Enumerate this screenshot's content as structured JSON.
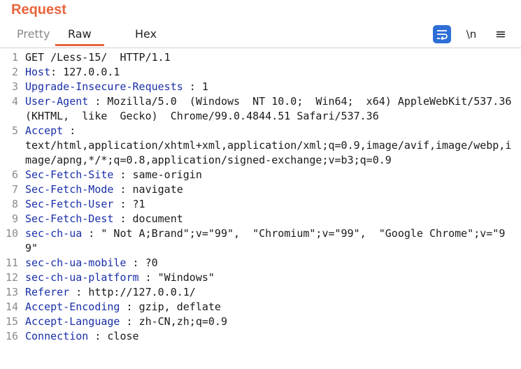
{
  "panel": {
    "title": "Request"
  },
  "tabs": [
    {
      "label": "Pretty",
      "active": false
    },
    {
      "label": "Raw",
      "active": true
    },
    {
      "label": "Hex",
      "active": false
    }
  ],
  "toolbar": {
    "newline_label": "\\n",
    "menu_label": "≡"
  },
  "colors": {
    "accent": "#e8643c",
    "header_name": "#1a2fa8",
    "line_number": "#8a8a8a",
    "wrap_button_bg": "#2e6fd6"
  },
  "icons": {
    "wrap": "wrap-text-icon",
    "newline": "show-newlines-icon",
    "menu": "hamburger-menu-icon"
  },
  "request": {
    "lines": [
      {
        "num": "1",
        "text": "GET /Less-15/  HTTP/1.1"
      },
      {
        "num": "2",
        "name": "Host",
        "sep": ": ",
        "value": "127.0.0.1"
      },
      {
        "num": "3",
        "name": "Upgrade-Insecure-Requests",
        "sep": " : ",
        "value": "1"
      },
      {
        "num": "4",
        "name": "User-Agent",
        "sep": " : ",
        "value": "Mozilla/5.0  (Windows  NT 10.0;  Win64;  x64) AppleWebKit/537.36  (KHTML,  like  Gecko)  Chrome/99.0.4844.51 Safari/537.36"
      },
      {
        "num": "5",
        "name": "Accept",
        "sep": " :",
        "value": "\ntext/html,application/xhtml+xml,application/xml;q=0.9,image/avif,image/webp,image/apng,*/*;q=0.8,application/signed-exchange;v=b3;q=0.9"
      },
      {
        "num": "6",
        "name": "Sec-Fetch-Site",
        "sep": " : ",
        "value": "same-origin"
      },
      {
        "num": "7",
        "name": "Sec-Fetch-Mode",
        "sep": " : ",
        "value": "navigate"
      },
      {
        "num": "8",
        "name": "Sec-Fetch-User",
        "sep": " : ",
        "value": "?1"
      },
      {
        "num": "9",
        "name": "Sec-Fetch-Dest",
        "sep": " : ",
        "value": "document"
      },
      {
        "num": "10",
        "name": "sec-ch-ua",
        "sep": " : ",
        "value": "\" Not A;Brand\";v=\"99\",  \"Chromium\";v=\"99\",  \"Google Chrome\";v=\"99\""
      },
      {
        "num": "11",
        "name": "sec-ch-ua-mobile",
        "sep": " : ",
        "value": "?0"
      },
      {
        "num": "12",
        "name": "sec-ch-ua-platform",
        "sep": " : ",
        "value": "\"Windows\""
      },
      {
        "num": "13",
        "name": "Referer",
        "sep": " : ",
        "value": "http://127.0.0.1/"
      },
      {
        "num": "14",
        "name": "Accept-Encoding",
        "sep": " : ",
        "value": "gzip, deflate"
      },
      {
        "num": "15",
        "name": "Accept-Language",
        "sep": " : ",
        "value": "zh-CN,zh;q=0.9"
      },
      {
        "num": "16",
        "name": "Connection",
        "sep": " : ",
        "value": "close"
      }
    ]
  }
}
